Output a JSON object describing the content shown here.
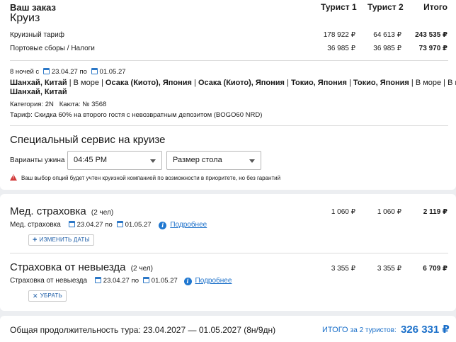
{
  "order": {
    "title": "Ваш заказ",
    "subtitle": "Круиз",
    "col_tourist1": "Турист 1",
    "col_tourist2": "Турист 2",
    "col_total": "Итого",
    "rows": [
      {
        "label": "Круизный тариф",
        "t1": "178 922 ₽",
        "t2": "64 613 ₽",
        "total": "243 535 ₽"
      },
      {
        "label": "Портовые сборы / Налоги",
        "t1": "36 985 ₽",
        "t2": "36 985 ₽",
        "total": "73 970 ₽"
      }
    ],
    "nights_prefix": "8 ночей с",
    "date_from": "23.04.27",
    "date_sep": "по",
    "date_to": "01.05.27",
    "route_line1_bold1": "Шанхай, Китай",
    "route_line1_rest": " | В море | ",
    "route_line1_bold2": "Осака (Киото), Япония",
    "route_line1_sep2": " | ",
    "route_line1_bold3": "Осака (Киото), Япония",
    "route_line1_sep3": " | ",
    "route_line1_bold4": "Токио, Япония",
    "route_line1_sep4": " | ",
    "route_line1_bold5": "Токио, Япония",
    "route_line1_tail": " | В море | В море |",
    "route_line2_bold": "Шанхай, Китай",
    "category": "Категория: 2N   Каюта: № 3568",
    "tariff": "Тариф: Скидка 60% на второго гостя с невозвратным депозитом (BOGO60 NRD)"
  },
  "special": {
    "title": "Специальный сервис на круизе",
    "dinner_label": "Варианты ужина",
    "dinner_value": "04:45 PM",
    "table_value": "Размер стола",
    "warning": "Ваш выбор опций будет учтен круизной компанией по возможности в приоритете, но без гарантий"
  },
  "insurance": [
    {
      "title": "Мед. страховка",
      "count": "(2 чел)",
      "t1": "1 060 ₽",
      "t2": "1 060 ₽",
      "total": "2 119 ₽",
      "sub_label": "Мед. страховка",
      "date_from": "23.04.27",
      "date_sep": "по",
      "date_to": "01.05.27",
      "more": "Подробнее",
      "button": "Изменить даты",
      "button_icon": "+"
    },
    {
      "title": "Страховка от невыезда",
      "count": "(2 чел)",
      "t1": "3 355 ₽",
      "t2": "3 355 ₽",
      "total": "6 709 ₽",
      "sub_label": "Страховка от невыезда",
      "date_from": "23.04.27",
      "date_sep": "по",
      "date_to": "01.05.27",
      "more": "Подробнее",
      "button": "Убрать",
      "button_icon": "✕"
    }
  ],
  "footer": {
    "duration": "Общая продолжительность тура: 23.04.2027 — 01.05.2027 (8н/9дн)",
    "total_label": "ИТОГО",
    "total_for": "за 2 туристов:",
    "total_value": "326 331 ₽"
  },
  "colors": {
    "accent": "#1a6fc9",
    "warning": "#d23b3b",
    "background": "#eceef1"
  }
}
